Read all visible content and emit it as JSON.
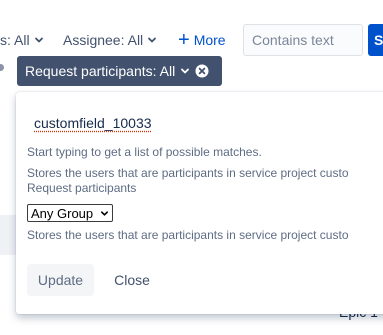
{
  "filters": {
    "status_label": "s: All",
    "assignee_label": "Assignee: All",
    "more_label": "More",
    "search_placeholder": "Contains text",
    "search_button_label": "S"
  },
  "active_filter": {
    "label": "Request participants: All"
  },
  "popup": {
    "field_value": "customfield_10033",
    "help_1": "Start typing to get a list of possible matches.",
    "help_2": "Stores the users that are participants in service project custo",
    "help_3": "Request participants",
    "select_value": "Any Group",
    "help_4": "Stores the users that are participants in service project custo",
    "update_label": "Update",
    "close_label": "Close"
  },
  "background": {
    "epic_text": "Epic 1"
  },
  "icons": {
    "status_chevron": "chevron-down-icon",
    "assignee_chevron": "chevron-down-icon",
    "more_plus": "plus-icon",
    "chip_chevron": "chevron-down-icon",
    "chip_clear": "close-circle-icon",
    "select_chevron": "chevron-down-icon"
  },
  "colors": {
    "link_blue": "#0052cc",
    "chip_bg": "#42526e",
    "text_primary": "#172b4d",
    "text_subtle": "#5e6c84"
  }
}
